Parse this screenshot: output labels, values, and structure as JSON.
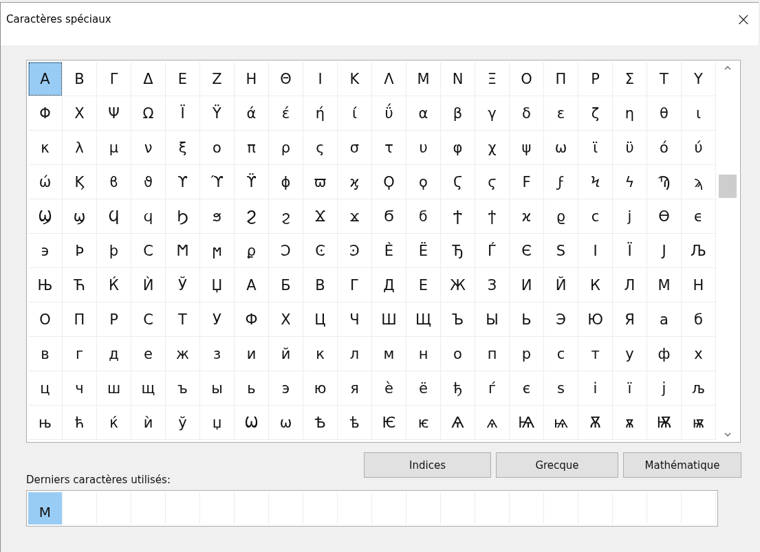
{
  "window": {
    "title": "Caractères spéciaux",
    "close": "×"
  },
  "grid": {
    "rows": [
      {
        "cells": [
          {
            "char": "Α",
            "selected": true
          },
          {
            "char": "Β",
            "selected": false
          },
          {
            "char": "Γ",
            "selected": false
          },
          {
            "char": "Δ",
            "selected": false
          },
          {
            "char": "Ε",
            "selected": false
          },
          {
            "char": "Ζ",
            "selected": false
          },
          {
            "char": "Η",
            "selected": false
          },
          {
            "char": "Θ",
            "selected": false
          },
          {
            "char": "Ι",
            "selected": false
          },
          {
            "char": "Κ",
            "selected": false
          },
          {
            "char": "Λ",
            "selected": false
          },
          {
            "char": "Μ",
            "selected": false
          },
          {
            "char": "Ν",
            "selected": false
          },
          {
            "char": "Ξ",
            "selected": false
          },
          {
            "char": "Ο",
            "selected": false
          },
          {
            "char": "Π",
            "selected": false
          },
          {
            "char": "Ρ",
            "selected": false
          },
          {
            "char": "Σ",
            "selected": false
          },
          {
            "char": "Τ",
            "selected": false
          },
          {
            "char": "Υ",
            "selected": false
          }
        ]
      },
      {
        "cells": [
          {
            "char": "Φ",
            "selected": false
          },
          {
            "char": "Χ",
            "selected": false
          },
          {
            "char": "Ψ",
            "selected": false
          },
          {
            "char": "Ω",
            "selected": false
          },
          {
            "char": "Ϊ",
            "selected": false
          },
          {
            "char": "Ϋ",
            "selected": false
          },
          {
            "char": "ά",
            "selected": false
          },
          {
            "char": "έ",
            "selected": false
          },
          {
            "char": "ή",
            "selected": false
          },
          {
            "char": "ί",
            "selected": false
          },
          {
            "char": "ΰ",
            "selected": false
          },
          {
            "char": "α",
            "selected": false
          },
          {
            "char": "β",
            "selected": false
          },
          {
            "char": "γ",
            "selected": false
          },
          {
            "char": "δ",
            "selected": false
          },
          {
            "char": "ε",
            "selected": false
          },
          {
            "char": "ζ",
            "selected": false
          },
          {
            "char": "η",
            "selected": false
          },
          {
            "char": "θ",
            "selected": false
          },
          {
            "char": "ι",
            "selected": false
          }
        ]
      },
      {
        "cells": [
          {
            "char": "κ",
            "selected": false
          },
          {
            "char": "λ",
            "selected": false
          },
          {
            "char": "μ",
            "selected": false
          },
          {
            "char": "ν",
            "selected": false
          },
          {
            "char": "ξ",
            "selected": false
          },
          {
            "char": "ο",
            "selected": false
          },
          {
            "char": "π",
            "selected": false
          },
          {
            "char": "ρ",
            "selected": false
          },
          {
            "char": "ς",
            "selected": false
          },
          {
            "char": "σ",
            "selected": false
          },
          {
            "char": "τ",
            "selected": false
          },
          {
            "char": "υ",
            "selected": false
          },
          {
            "char": "φ",
            "selected": false
          },
          {
            "char": "χ",
            "selected": false
          },
          {
            "char": "ψ",
            "selected": false
          },
          {
            "char": "ω",
            "selected": false
          },
          {
            "char": "ϊ",
            "selected": false
          },
          {
            "char": "ϋ",
            "selected": false
          },
          {
            "char": "ό",
            "selected": false
          },
          {
            "char": "ύ",
            "selected": false
          }
        ]
      },
      {
        "cells": [
          {
            "char": "ώ",
            "selected": false
          },
          {
            "char": "Ϗ",
            "selected": false
          },
          {
            "char": "ϐ",
            "selected": false
          },
          {
            "char": "ϑ",
            "selected": false
          },
          {
            "char": "ϒ",
            "selected": false
          },
          {
            "char": "ϓ",
            "selected": false
          },
          {
            "char": "ϔ",
            "selected": false
          },
          {
            "char": "ϕ",
            "selected": false
          },
          {
            "char": "ϖ",
            "selected": false
          },
          {
            "char": "ϗ",
            "selected": false
          },
          {
            "char": "Ϙ",
            "selected": false
          },
          {
            "char": "ϙ",
            "selected": false
          },
          {
            "char": "Ϛ",
            "selected": false
          },
          {
            "char": "ϛ",
            "selected": false
          },
          {
            "char": "Ϝ",
            "selected": false
          },
          {
            "char": "ϝ",
            "selected": false
          },
          {
            "char": "Ϟ",
            "selected": false
          },
          {
            "char": "ϟ",
            "selected": false
          },
          {
            "char": "Ϡ",
            "selected": false
          },
          {
            "char": "ϡ",
            "selected": false
          }
        ]
      },
      {
        "cells": [
          {
            "char": "Ϣ",
            "selected": false
          },
          {
            "char": "ϣ",
            "selected": false
          },
          {
            "char": "Ϥ",
            "selected": false
          },
          {
            "char": "ϥ",
            "selected": false
          },
          {
            "char": "Ϧ",
            "selected": false
          },
          {
            "char": "ϧ",
            "selected": false
          },
          {
            "char": "Ϩ",
            "selected": false
          },
          {
            "char": "ϩ",
            "selected": false
          },
          {
            "char": "Ϫ",
            "selected": false
          },
          {
            "char": "ϫ",
            "selected": false
          },
          {
            "char": "Ϭ",
            "selected": false
          },
          {
            "char": "ϭ",
            "selected": false
          },
          {
            "char": "Ϯ",
            "selected": false
          },
          {
            "char": "ϯ",
            "selected": false
          },
          {
            "char": "ϰ",
            "selected": false
          },
          {
            "char": "ϱ",
            "selected": false
          },
          {
            "char": "ϲ",
            "selected": false
          },
          {
            "char": "ϳ",
            "selected": false
          },
          {
            "char": "ϴ",
            "selected": false
          },
          {
            "char": "ϵ",
            "selected": false
          }
        ]
      },
      {
        "cells": [
          {
            "char": "϶",
            "selected": false
          },
          {
            "char": "Ϸ",
            "selected": false
          },
          {
            "char": "ϸ",
            "selected": false
          },
          {
            "char": "Ϲ",
            "selected": false
          },
          {
            "char": "Ϻ",
            "selected": false
          },
          {
            "char": "ϻ",
            "selected": false
          },
          {
            "char": "ϼ",
            "selected": false
          },
          {
            "char": "Ͻ",
            "selected": false
          },
          {
            "char": "Ͼ",
            "selected": false
          },
          {
            "char": "Ͽ",
            "selected": false
          },
          {
            "char": "Ѐ",
            "selected": false
          },
          {
            "char": "Ё",
            "selected": false
          },
          {
            "char": "Ђ",
            "selected": false
          },
          {
            "char": "Ѓ",
            "selected": false
          },
          {
            "char": "Є",
            "selected": false
          },
          {
            "char": "Ѕ",
            "selected": false
          },
          {
            "char": "І",
            "selected": false
          },
          {
            "char": "Ї",
            "selected": false
          },
          {
            "char": "Ј",
            "selected": false
          },
          {
            "char": "Љ",
            "selected": false
          }
        ]
      },
      {
        "cells": [
          {
            "char": "Њ",
            "selected": false
          },
          {
            "char": "Ћ",
            "selected": false
          },
          {
            "char": "Ќ",
            "selected": false
          },
          {
            "char": "Ѝ",
            "selected": false
          },
          {
            "char": "Ў",
            "selected": false
          },
          {
            "char": "Џ",
            "selected": false
          },
          {
            "char": "А",
            "selected": false
          },
          {
            "char": "Б",
            "selected": false
          },
          {
            "char": "В",
            "selected": false
          },
          {
            "char": "Г",
            "selected": false
          },
          {
            "char": "Д",
            "selected": false
          },
          {
            "char": "Е",
            "selected": false
          },
          {
            "char": "Ж",
            "selected": false
          },
          {
            "char": "З",
            "selected": false
          },
          {
            "char": "И",
            "selected": false
          },
          {
            "char": "Й",
            "selected": false
          },
          {
            "char": "К",
            "selected": false
          },
          {
            "char": "Л",
            "selected": false
          },
          {
            "char": "М",
            "selected": false
          },
          {
            "char": "Н",
            "selected": false
          }
        ]
      },
      {
        "cells": [
          {
            "char": "О",
            "selected": false
          },
          {
            "char": "П",
            "selected": false
          },
          {
            "char": "Р",
            "selected": false
          },
          {
            "char": "С",
            "selected": false
          },
          {
            "char": "Т",
            "selected": false
          },
          {
            "char": "У",
            "selected": false
          },
          {
            "char": "Ф",
            "selected": false
          },
          {
            "char": "Х",
            "selected": false
          },
          {
            "char": "Ц",
            "selected": false
          },
          {
            "char": "Ч",
            "selected": false
          },
          {
            "char": "Ш",
            "selected": false
          },
          {
            "char": "Щ",
            "selected": false
          },
          {
            "char": "Ъ",
            "selected": false
          },
          {
            "char": "Ы",
            "selected": false
          },
          {
            "char": "Ь",
            "selected": false
          },
          {
            "char": "Э",
            "selected": false
          },
          {
            "char": "Ю",
            "selected": false
          },
          {
            "char": "Я",
            "selected": false
          },
          {
            "char": "а",
            "selected": false
          },
          {
            "char": "б",
            "selected": false
          }
        ]
      },
      {
        "cells": [
          {
            "char": "в",
            "selected": false
          },
          {
            "char": "г",
            "selected": false
          },
          {
            "char": "д",
            "selected": false
          },
          {
            "char": "е",
            "selected": false
          },
          {
            "char": "ж",
            "selected": false
          },
          {
            "char": "з",
            "selected": false
          },
          {
            "char": "и",
            "selected": false
          },
          {
            "char": "й",
            "selected": false
          },
          {
            "char": "к",
            "selected": false
          },
          {
            "char": "л",
            "selected": false
          },
          {
            "char": "м",
            "selected": false
          },
          {
            "char": "н",
            "selected": false
          },
          {
            "char": "о",
            "selected": false
          },
          {
            "char": "п",
            "selected": false
          },
          {
            "char": "р",
            "selected": false
          },
          {
            "char": "с",
            "selected": false
          },
          {
            "char": "т",
            "selected": false
          },
          {
            "char": "у",
            "selected": false
          },
          {
            "char": "ф",
            "selected": false
          },
          {
            "char": "х",
            "selected": false
          }
        ]
      },
      {
        "cells": [
          {
            "char": "ц",
            "selected": false
          },
          {
            "char": "ч",
            "selected": false
          },
          {
            "char": "ш",
            "selected": false
          },
          {
            "char": "щ",
            "selected": false
          },
          {
            "char": "ъ",
            "selected": false
          },
          {
            "char": "ы",
            "selected": false
          },
          {
            "char": "ь",
            "selected": false
          },
          {
            "char": "э",
            "selected": false
          },
          {
            "char": "ю",
            "selected": false
          },
          {
            "char": "я",
            "selected": false
          },
          {
            "char": "ѐ",
            "selected": false
          },
          {
            "char": "ё",
            "selected": false
          },
          {
            "char": "ђ",
            "selected": false
          },
          {
            "char": "ѓ",
            "selected": false
          },
          {
            "char": "є",
            "selected": false
          },
          {
            "char": "ѕ",
            "selected": false
          },
          {
            "char": "і",
            "selected": false
          },
          {
            "char": "ї",
            "selected": false
          },
          {
            "char": "ј",
            "selected": false
          },
          {
            "char": "љ",
            "selected": false
          }
        ]
      },
      {
        "cells": [
          {
            "char": "њ",
            "selected": false
          },
          {
            "char": "ћ",
            "selected": false
          },
          {
            "char": "ќ",
            "selected": false
          },
          {
            "char": "ѝ",
            "selected": false
          },
          {
            "char": "ў",
            "selected": false
          },
          {
            "char": "џ",
            "selected": false
          },
          {
            "char": "Ѡ",
            "selected": false
          },
          {
            "char": "ѡ",
            "selected": false
          },
          {
            "char": "Ѣ",
            "selected": false
          },
          {
            "char": "ѣ",
            "selected": false
          },
          {
            "char": "Ѥ",
            "selected": false
          },
          {
            "char": "ѥ",
            "selected": false
          },
          {
            "char": "Ѧ",
            "selected": false
          },
          {
            "char": "ѧ",
            "selected": false
          },
          {
            "char": "Ѩ",
            "selected": false
          },
          {
            "char": "ѩ",
            "selected": false
          },
          {
            "char": "Ѫ",
            "selected": false
          },
          {
            "char": "ѫ",
            "selected": false
          },
          {
            "char": "Ѭ",
            "selected": false
          },
          {
            "char": "ѭ",
            "selected": false
          }
        ]
      }
    ]
  },
  "buttons": [
    "Indices",
    "Grecque",
    "Mathématique"
  ],
  "recent": {
    "label": "Derniers caractères utilisés:",
    "items": [
      {
        "char": "M",
        "selected": true
      }
    ]
  }
}
